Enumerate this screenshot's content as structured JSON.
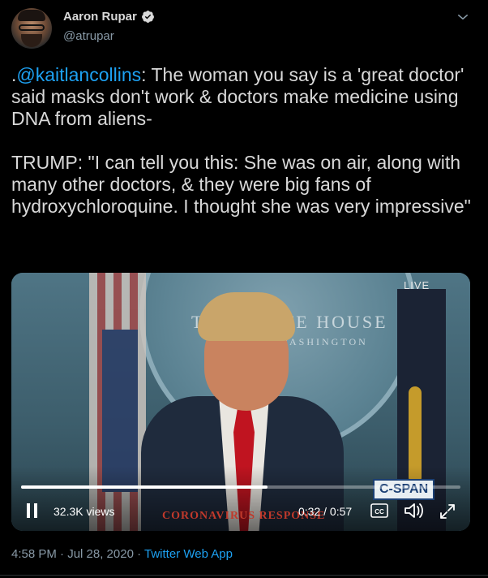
{
  "author": {
    "display_name": "Aaron Rupar",
    "handle": "@atrupar",
    "verified": true
  },
  "tweet": {
    "prefix": ".",
    "mention": "@kaitlancollins",
    "body": ": The woman you say is a 'great doctor' said masks don't work & doctors make medicine using DNA from aliens-\n\nTRUMP: \"I can tell you this: She was on air, along with many other doctors, & they were big fans of hydroxychloroquine. I thought she was very impressive\""
  },
  "video": {
    "live_label": "LIVE",
    "network_label": "C-SPAN",
    "chyron_text": "CORONAVIRUS RESPONSE",
    "background_text_line1": "THE WHITE HOUSE",
    "background_text_line2": "WASHINGTON",
    "views": "32.3K views",
    "time": "0:32 / 0:57",
    "progress": 0.56
  },
  "footer": {
    "timestamp": "4:58 PM · Jul 28, 2020",
    "separator": " · ",
    "source": "Twitter Web App"
  },
  "colors": {
    "background": "#000000",
    "text": "#d9d9d9",
    "muted": "#8899a6",
    "accent": "#1da1f2"
  },
  "icons": [
    "verified-badge-icon",
    "caret-down-icon",
    "pause-icon",
    "closed-captions-icon",
    "volume-icon",
    "fullscreen-icon"
  ]
}
